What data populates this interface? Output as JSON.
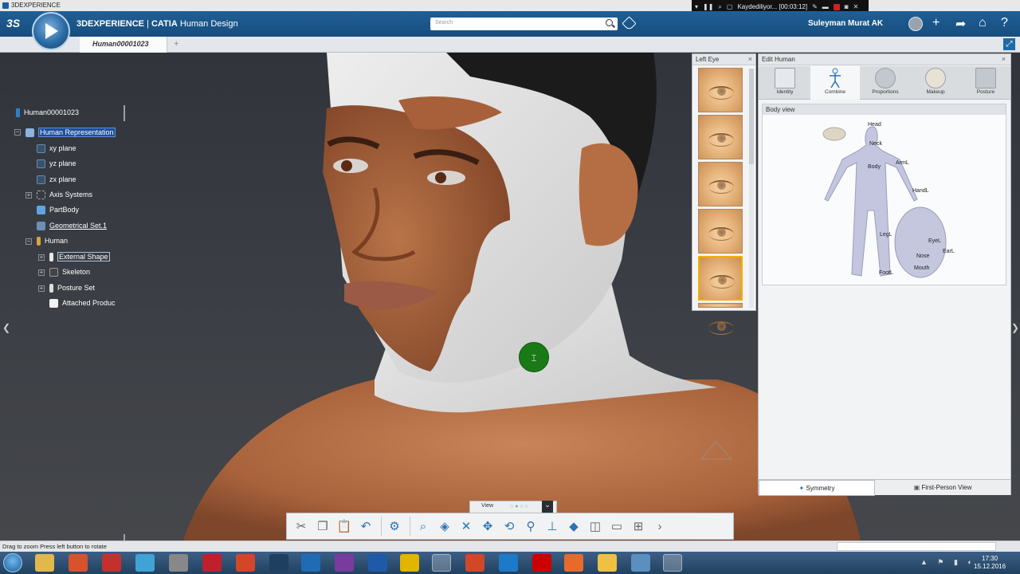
{
  "os": {
    "window_title": "3DEXPERIENCE"
  },
  "recorder": {
    "status": "Kaydediliyor... [00:03:12]"
  },
  "header": {
    "brand_3d": "3DEXPERIENCE",
    "brand_sep": " | ",
    "brand_catia": "CATIA",
    "app_name": " Human Design",
    "search_placeholder": "Search",
    "user_name": "Suleyman Murat AK",
    "compass_label": "3D compass",
    "ds_logo": "3S"
  },
  "tabs": {
    "active": "Human00001023",
    "add": "+"
  },
  "tree": {
    "root": "Human00001023",
    "items": [
      {
        "label": "Human Representation"
      },
      {
        "label": "xy plane"
      },
      {
        "label": "yz plane"
      },
      {
        "label": "zx plane"
      },
      {
        "label": "Axis Systems"
      },
      {
        "label": "PartBody"
      },
      {
        "label": "Geometrical Set.1"
      },
      {
        "label": "Human"
      },
      {
        "label": "External Shape"
      },
      {
        "label": "Skeleton"
      },
      {
        "label": "Posture Set"
      },
      {
        "label": "Attached Produc"
      }
    ]
  },
  "left_eye_panel": {
    "title": "Left Eye",
    "close": "×",
    "thumb_count": 5,
    "selected_index": 4
  },
  "edit_human": {
    "title": "Edit Human",
    "close": "×",
    "tabs": [
      {
        "label": "Identity"
      },
      {
        "label": "Combine"
      },
      {
        "label": "Proportions"
      },
      {
        "label": "Makeup"
      },
      {
        "label": "Posture"
      }
    ],
    "active_tab": "Combine",
    "body_view_title": "Body view",
    "body_labels": {
      "head": "Head",
      "neck": "Neck",
      "body": "Body",
      "arml": "ArmL",
      "handl": "HandL",
      "legl": "LegL",
      "footl": "FootL",
      "eyel": "EyeL",
      "earl": "EarL",
      "nose": "Nose",
      "mouth": "Mouth"
    },
    "symmetry": "Symmetry",
    "first_person": "First-Person View"
  },
  "view_tab": {
    "label": "View"
  },
  "status": {
    "text": "Drag to zoom  Press left button to rotate"
  },
  "clock": {
    "time": "17:30",
    "date": "15.12.2016"
  },
  "colors": {
    "header_blue": "#1f5f96",
    "skin": "#b9714a",
    "selection": "#1e4f9a",
    "accent": "#2a74b5"
  }
}
